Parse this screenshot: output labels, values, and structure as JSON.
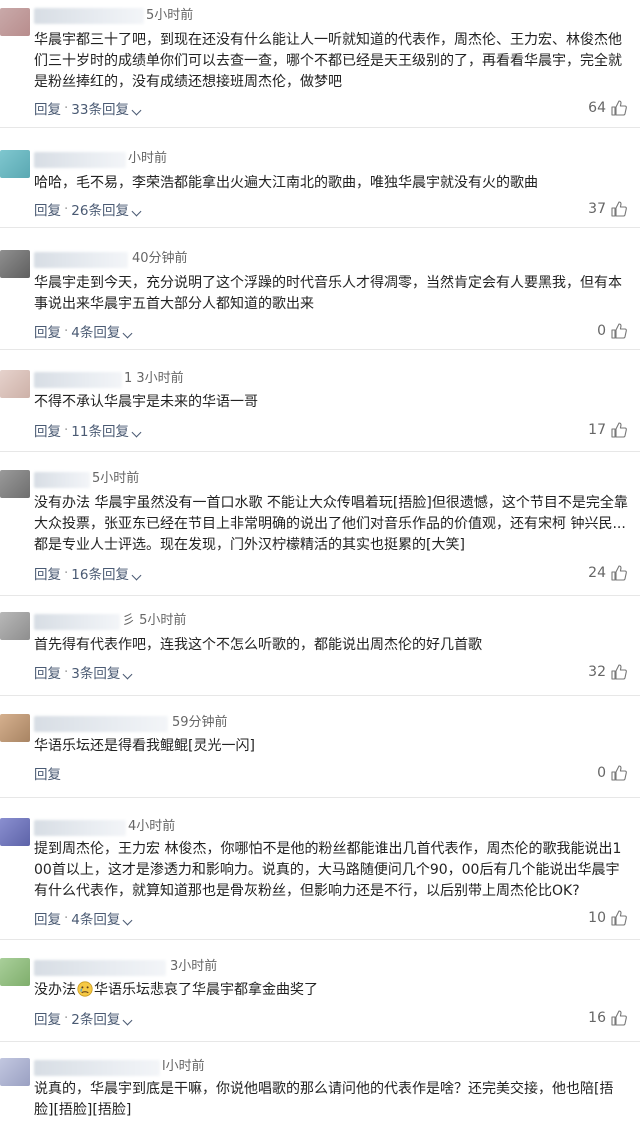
{
  "colors": {
    "link": "#4a5a73",
    "text": "#222222",
    "muted": "#666666",
    "divider": "#e7e7e7"
  },
  "comments": [
    {
      "time": "5小时前",
      "content": "华晨宇都三十了吧，到现在还没有什么能让人一听就知道的代表作，周杰伦、王力宏、林俊杰他们三十岁时的成绩单你们可以去查一查，哪个不都已经是天王级别的了，再看看华晨宇，完全就是粉丝捧红的，没有成绩还想接班周杰伦，做梦吧",
      "reply_label": "回复",
      "replies_label": "33条回复",
      "likes": "64"
    },
    {
      "time": "小时前",
      "content": "哈哈，毛不易，李荣浩都能拿出火遍大江南北的歌曲，唯独华晨宇就没有火的歌曲",
      "reply_label": "回复",
      "replies_label": "26条回复",
      "likes": "37"
    },
    {
      "time": "40分钟前",
      "content": "华晨宇走到今天，充分说明了这个浮躁的时代音乐人才得凋零，当然肯定会有人要黑我，但有本事说出来华晨宇五首大部分人都知道的歌出来",
      "reply_label": "回复",
      "replies_label": "4条回复",
      "likes": "0"
    },
    {
      "time": "1 3小时前",
      "content": "不得不承认华晨宇是未来的华语一哥",
      "reply_label": "回复",
      "replies_label": "11条回复",
      "likes": "17"
    },
    {
      "time": "5小时前",
      "content": "没有办法 华晨宇虽然没有一首口水歌 不能让大众传唱着玩[捂脸]但很遗憾，这个节目不是完全靠大众投票，张亚东已经在节目上非常明确的说出了他们对音乐作品的价值观，还有宋柯 钟兴民...都是专业人士评选。现在发现，门外汉柠檬精活的其实也挺累的[大笑]",
      "reply_label": "回复",
      "replies_label": "16条回复",
      "likes": "24"
    },
    {
      "time": "彡 5小时前",
      "content": "首先得有代表作吧，连我这个不怎么听歌的，都能说出周杰伦的好几首歌",
      "reply_label": "回复",
      "replies_label": "3条回复",
      "likes": "32"
    },
    {
      "time": "59分钟前",
      "content": "华语乐坛还是得看我鲲鲲[灵光一闪]",
      "reply_label": "回复",
      "replies_label": "",
      "likes": "0"
    },
    {
      "time": "4小时前",
      "content": "提到周杰伦，王力宏 林俊杰，你哪怕不是他的粉丝都能谁出几首代表作，周杰伦的歌我能说出100首以上，这才是渗透力和影响力。说真的，大马路随便问几个90，00后有几个能说出华晨宇有什么代表作，就算知道那也是骨灰粉丝，但影响力还是不行，以后别带上周杰伦比OK?",
      "reply_label": "回复",
      "replies_label": "4条回复",
      "likes": "10"
    },
    {
      "time": "3小时前",
      "content_before_emoji": "没办法",
      "emoji_icon": "crying-face-icon",
      "content_after_emoji": "华语乐坛悲哀了华晨宇都拿金曲奖了",
      "reply_label": "回复",
      "replies_label": "2条回复",
      "likes": "16"
    },
    {
      "time": "l小时前",
      "content": "说真的，华晨宇到底是干嘛，你说他唱歌的那么请问他的代表作是啥？还完美交接，他也陪[捂脸][捂脸][捂脸]",
      "reply_label": "",
      "replies_label": "",
      "likes": ""
    }
  ]
}
